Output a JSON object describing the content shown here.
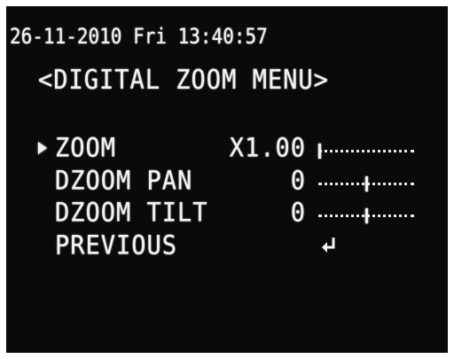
{
  "osd": {
    "datetime": "26-11-2010 Fri 13:40:57",
    "menu_title": "<DIGITAL ZOOM MENU>",
    "items": [
      {
        "label": "ZOOM",
        "value": "X1.00",
        "selected": true,
        "slider_level": 0.0
      },
      {
        "label": "DZOOM PAN",
        "value": "0",
        "selected": false,
        "slider_level": 0.5
      },
      {
        "label": "DZOOM TILT",
        "value": "0",
        "selected": false,
        "slider_level": 0.5
      },
      {
        "label": "PREVIOUS",
        "icon": "enter-return-icon",
        "selected": false
      }
    ],
    "colors": {
      "background": "#0a0a0a",
      "text": "#f2f2f2",
      "frame": "#ffffff"
    }
  }
}
